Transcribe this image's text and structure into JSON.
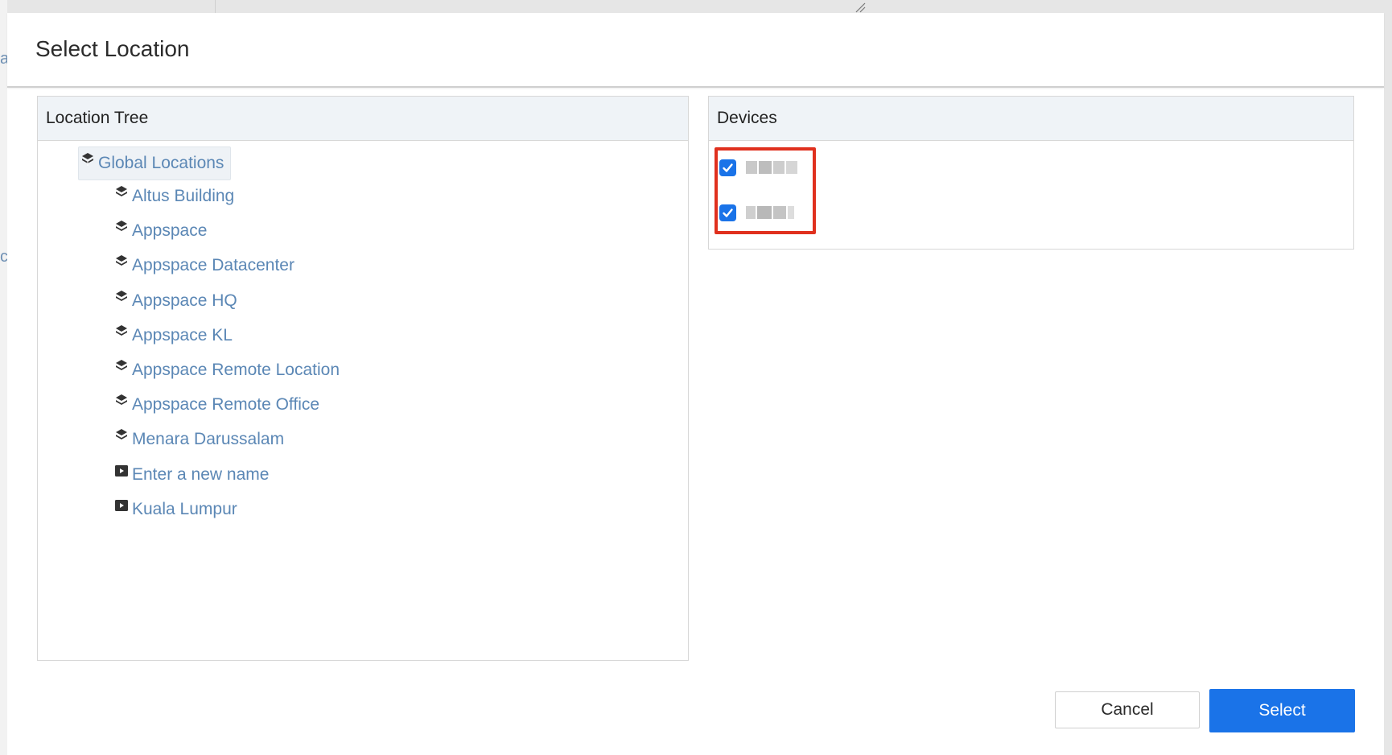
{
  "background": {
    "left_fragments": [
      "a",
      "ci"
    ]
  },
  "dialog": {
    "title": "Select Location"
  },
  "tree_panel": {
    "header": "Location Tree",
    "root": {
      "label": "Global Locations",
      "icon": "location-group-icon"
    },
    "items": [
      {
        "label": "Altus Building",
        "icon": "location-group-icon"
      },
      {
        "label": "Appspace",
        "icon": "location-group-icon"
      },
      {
        "label": "Appspace Datacenter",
        "icon": "location-group-icon"
      },
      {
        "label": "Appspace HQ",
        "icon": "location-group-icon"
      },
      {
        "label": "Appspace KL",
        "icon": "location-group-icon"
      },
      {
        "label": "Appspace Remote Location",
        "icon": "location-group-icon"
      },
      {
        "label": "Appspace Remote Office",
        "icon": "location-group-icon"
      },
      {
        "label": "Menara Darussalam",
        "icon": "location-group-icon"
      },
      {
        "label": "Enter a new name",
        "icon": "device-screen-icon"
      },
      {
        "label": "Kuala Lumpur",
        "icon": "device-screen-icon"
      }
    ]
  },
  "devices_panel": {
    "header": "Devices",
    "devices": [
      {
        "checked": true,
        "name_redacted": true
      },
      {
        "checked": true,
        "name_redacted": true
      }
    ],
    "highlight_color": "#e0301e"
  },
  "footer": {
    "cancel_label": "Cancel",
    "select_label": "Select"
  },
  "colors": {
    "accent": "#1a73e8",
    "link": "#5b87b5",
    "panel_header_bg": "#eff3f7"
  }
}
